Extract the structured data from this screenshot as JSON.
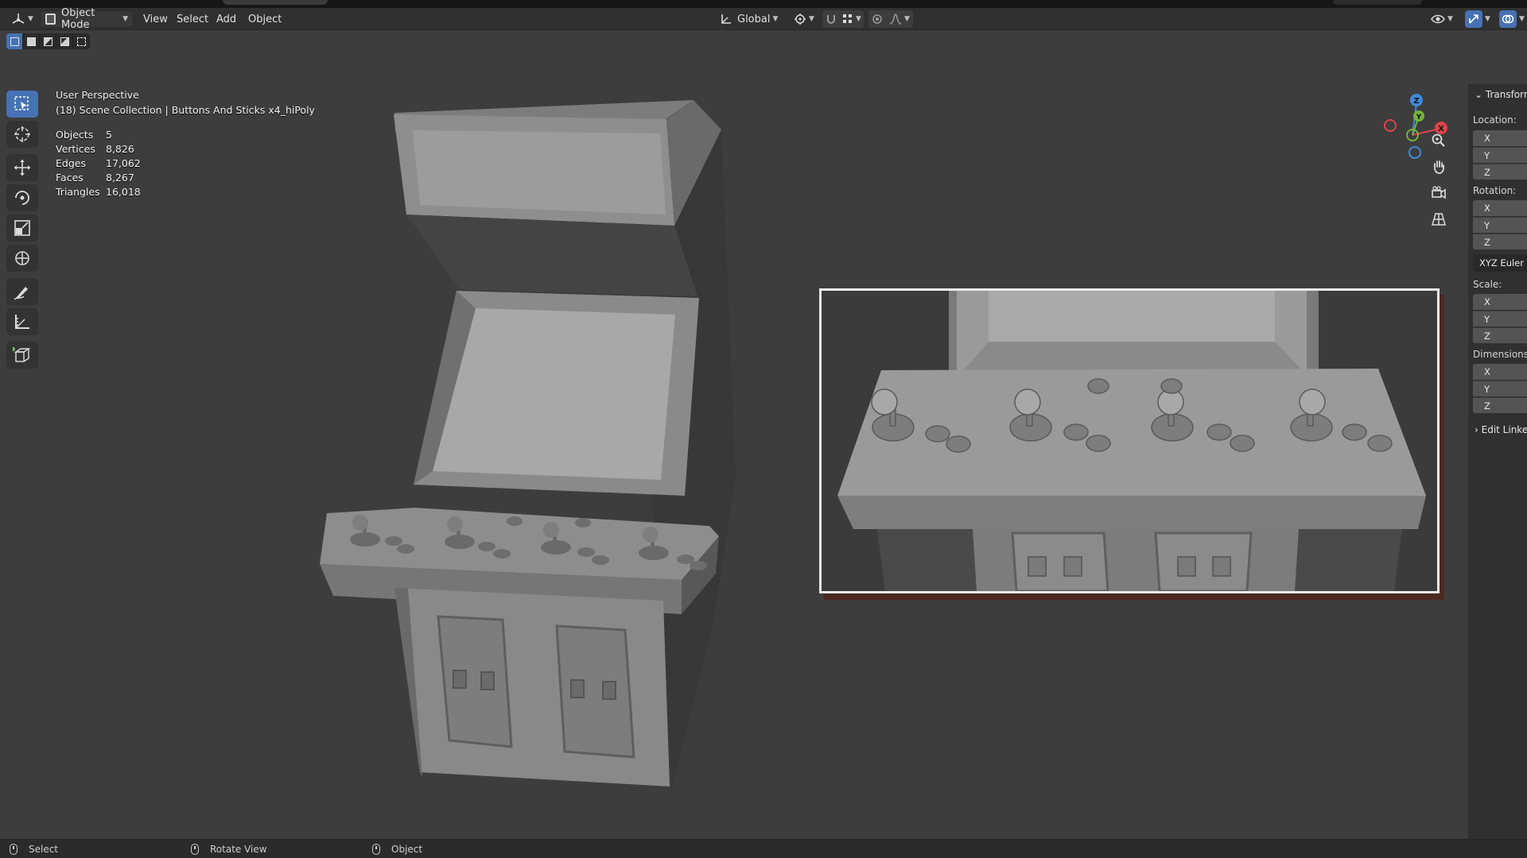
{
  "header": {
    "mode": "Object Mode",
    "menus": [
      "View",
      "Select",
      "Add",
      "Object"
    ],
    "transform_orientation": "Global"
  },
  "viewport": {
    "view_name": "User Perspective",
    "collection_path": "(18) Scene Collection | Buttons And Sticks x4_hiPoly",
    "stats": [
      {
        "label": "Objects",
        "value": "5"
      },
      {
        "label": "Vertices",
        "value": "8,826"
      },
      {
        "label": "Edges",
        "value": "17,062"
      },
      {
        "label": "Faces",
        "value": "8,267"
      },
      {
        "label": "Triangles",
        "value": "16,018"
      }
    ],
    "gizmo_axes": {
      "x": "X",
      "y": "Y",
      "z": "Z"
    },
    "axis_colors": {
      "x": "#e0434b",
      "y": "#75b33a",
      "z": "#3f8ad8"
    }
  },
  "sidebar": {
    "transform_title": "Transform",
    "location_label": "Location:",
    "rotation_label": "Rotation:",
    "rotation_mode": "XYZ Euler",
    "scale_label": "Scale:",
    "dimensions_label": "Dimensions",
    "edit_linked_label": "Edit Linke",
    "axes": [
      "X",
      "Y",
      "Z"
    ]
  },
  "statusbar": {
    "left_click": "Select",
    "middle_click": "Rotate View",
    "right_click": "Object"
  },
  "tools": [
    "select-box",
    "cursor",
    "move",
    "rotate",
    "scale",
    "transform",
    "annotate",
    "measure",
    "add-cube"
  ],
  "colors": {
    "accent": "#4772b3",
    "viewport_bg": "#3d3d3d",
    "model_gray": "#8a8a8a"
  }
}
